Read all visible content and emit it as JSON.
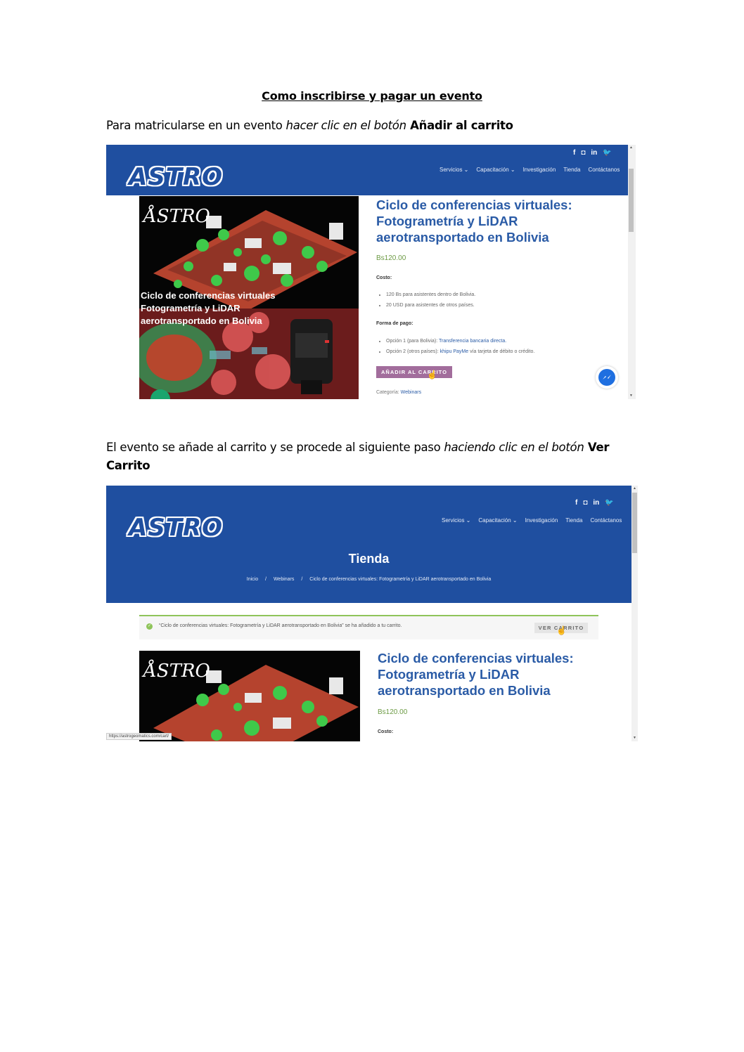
{
  "document": {
    "title": "Como inscribirse y pagar un evento",
    "para1": {
      "a": "Para matricularse en un evento ",
      "b": "hacer clic en el botón",
      "c": " Añadir al carrito"
    },
    "para2": {
      "a": "El evento se añade al carrito y se procede al siguiente paso ",
      "b": "haciendo clic en el botón",
      "c": " Ver Carrito"
    }
  },
  "site": {
    "logo": "ASTRO",
    "social": [
      "f",
      "◘",
      "in",
      "🐦"
    ],
    "nav": [
      "Servicios ⌄",
      "Capacitación ⌄",
      "Investigación",
      "Tienda",
      "Contáctanos"
    ]
  },
  "product": {
    "image_mark": "ÅSTRO",
    "image_caption": [
      "Ciclo de conferencias virtuales",
      "Fotogrametría y LiDAR",
      "aerotransportado en Bolivia"
    ],
    "title": "Ciclo de conferencias virtuales: Fotogrametría y LiDAR aerotransportado en Bolivia",
    "price": "Bs120.00",
    "cost_label": "Costo:",
    "cost_items": [
      "120 Bs para asistentes dentro de Bolivia.",
      "20 USD para asistentes de otros países."
    ],
    "payment_label": "Forma de pago:",
    "payment_1_prefix": "Opción 1 (para Bolivia): ",
    "payment_1_link": "Transferencia bancaria directa.",
    "payment_2_prefix": "Opción 2 (otros países): ",
    "payment_2_link": "khipu PayMe",
    "payment_2_suffix": " vía tarjeta de débito o crédito.",
    "add_to_cart": "AÑADIR AL CARRITO",
    "category_label": "Categoría: ",
    "category_value": "Webinars"
  },
  "shop": {
    "title": "Tienda",
    "breadcrumb": [
      "Inicio",
      "/",
      "Webinars",
      "/",
      "Ciclo de conferencias virtuales: Fotogrametría y LiDAR aerotransportado en Bolivia"
    ],
    "notice": "“Ciclo de conferencias virtuales: Fotogrametría y LiDAR aerotransportado en Bolivia” se ha añadido a tu carrito.",
    "view_cart": "VER CARRITO",
    "status_url": "https://astrogeomatics.com/cart/"
  }
}
